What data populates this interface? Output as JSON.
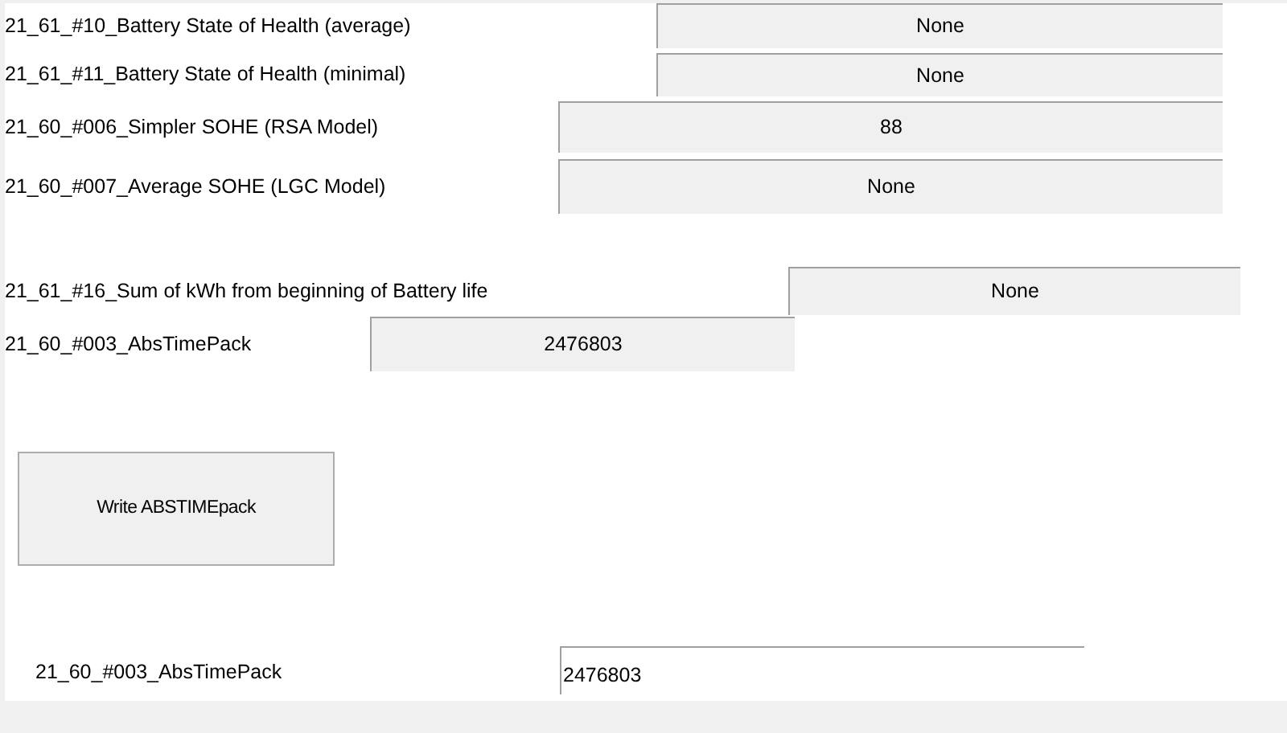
{
  "readings": [
    {
      "label": "21_61_#10_Battery State of Health (average)",
      "value": "None"
    },
    {
      "label": "21_61_#11_Battery State of Health (minimal)",
      "value": "None"
    },
    {
      "label": "21_60_#006_Simpler SOHE (RSA Model)",
      "value": "88"
    },
    {
      "label": "21_60_#007_Average SOHE (LGC Model)",
      "value": "None"
    },
    {
      "label": "21_61_#16_Sum of kWh from beginning of Battery life",
      "value": "None"
    },
    {
      "label": "21_60_#003_AbsTimePack",
      "value": "2476803"
    }
  ],
  "write_button": "Write ABSTIMEpack",
  "input_row": {
    "label": "21_60_#003_AbsTimePack",
    "value": "2476803"
  }
}
